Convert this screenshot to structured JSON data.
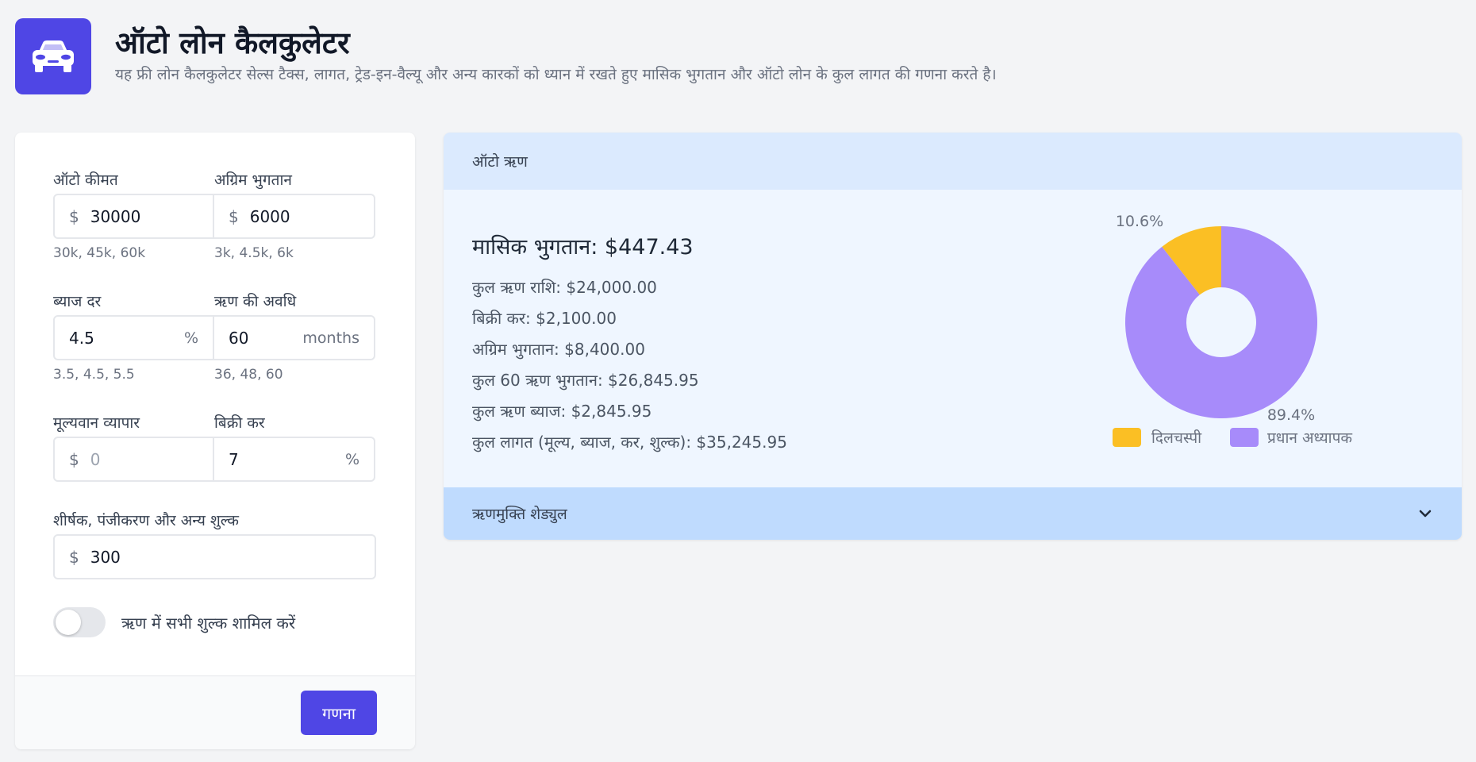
{
  "header": {
    "title": "ऑटो लोन कैलकुलेटर",
    "subtitle": "यह फ्री लोन कैलकुलेटर सेल्स टैक्स, लागत, ट्रेड-इन-वैल्यू और अन्य कारकों को ध्यान में रखते हुए मासिक भुगतान और ऑटो लोन के कुल लागत की गणना करते है।",
    "logo_icon": "car-icon",
    "accent_color": "#4f46e5"
  },
  "form": {
    "auto_price": {
      "label": "ऑटो कीमत",
      "prefix": "$",
      "value": "30000",
      "hint": "30k, 45k, 60k"
    },
    "down_payment": {
      "label": "अग्रिम भुगतान",
      "prefix": "$",
      "value": "6000",
      "hint": "3k, 4.5k, 6k"
    },
    "interest_rate": {
      "label": "ब्याज दर",
      "value": "4.5",
      "suffix": "%",
      "hint": "3.5, 4.5, 5.5"
    },
    "loan_term": {
      "label": "ऋण की अवधि",
      "value": "60",
      "suffix": "months",
      "hint": "36, 48, 60"
    },
    "trade_in": {
      "label": "मूल्यवान व्यापार",
      "prefix": "$",
      "value": "0"
    },
    "sales_tax": {
      "label": "बिक्री कर",
      "value": "7",
      "suffix": "%"
    },
    "fees": {
      "label": "शीर्षक, पंजीकरण और अन्य शुल्क",
      "prefix": "$",
      "value": "300"
    },
    "include_fees": {
      "label": "ऋण में सभी शुल्क शामिल करें",
      "checked": false
    },
    "calculate_label": "गणना"
  },
  "results": {
    "header": "ऑटो ऋण",
    "monthly_payment": "मासिक भुगतान: $447.43",
    "summary": [
      "कुल ऋण राशि: $24,000.00",
      "बिक्री कर: $2,100.00",
      "अग्रिम भुगतान: $8,400.00",
      "कुल 60 ऋण भुगतान: $26,845.95",
      "कुल ऋण ब्याज: $2,845.95",
      "कुल लागत (मूल्य, ब्याज, कर, शुल्क): $35,245.95"
    ],
    "schedule_label": "ऋणमुक्ति शेड्युल",
    "schedule_icon": "chevron-down-icon"
  },
  "chart_data": {
    "type": "pie",
    "categories": [
      "दिलचस्पी",
      "प्रधान अध्यापक"
    ],
    "values": [
      10.6,
      89.4
    ],
    "labels": [
      "10.6%",
      "89.4%"
    ],
    "colors": [
      "#fbbf24",
      "#a78bfa"
    ],
    "legend_position": "bottom"
  }
}
